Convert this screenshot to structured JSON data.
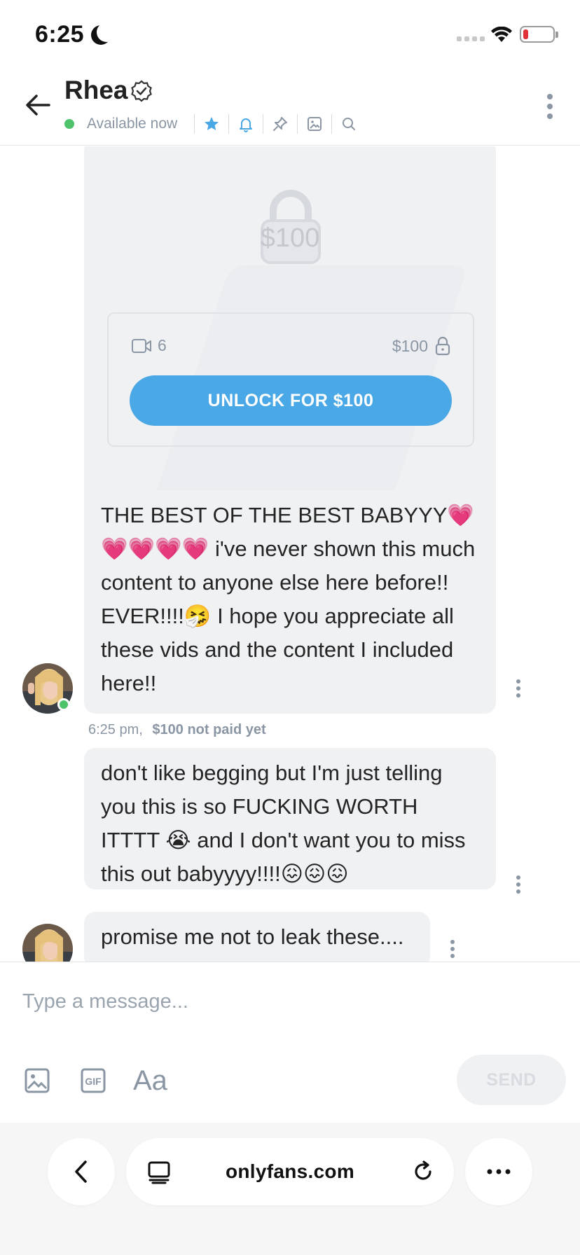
{
  "status_bar": {
    "time": "6:25"
  },
  "header": {
    "contact_name": "Rhea",
    "availability": "Available now"
  },
  "media_card": {
    "lock_price": "$100",
    "video_count": "6",
    "price": "$100",
    "unlock_label": "UNLOCK FOR $100"
  },
  "messages": [
    {
      "text": "THE BEST OF THE BEST BABYYY💗💗💗💗💗 i've never shown this much content to anyone else here before!! EVER!!!!🤧 I hope you appreciate all these vids and the content I included here!!",
      "time": "6:25 pm,",
      "payment_status": "$100 not paid yet"
    },
    {
      "text": "don't like begging but I'm just telling you this is so FUCKING WORTH ITTTT 😭 and I don't want you to miss this out babyyyy!!!!😖😖😖"
    },
    {
      "text": "promise me not to leak these...."
    }
  ],
  "composer": {
    "placeholder": "Type a message...",
    "text_format_label": "Aa",
    "send_label": "SEND"
  },
  "browser": {
    "url": "onlyfans.com"
  },
  "colors": {
    "accent": "#4ba8e6",
    "online": "#4fc26c",
    "muted": "#8a96a3",
    "bubble_bg": "#f0f1f3"
  }
}
